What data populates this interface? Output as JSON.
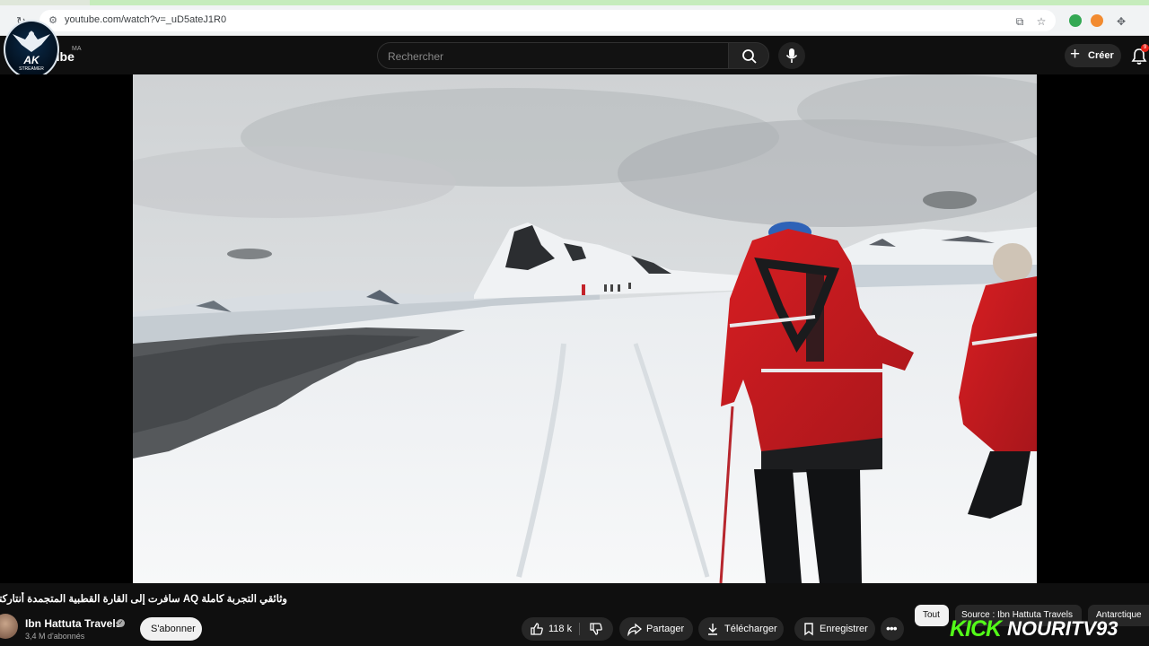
{
  "browser": {
    "url": "youtube.com/watch?v=_uD5ateJ1R0"
  },
  "header": {
    "logo_text": "ube",
    "country_code": "MA",
    "search_placeholder": "Rechercher",
    "create_label": "Créer",
    "notification_count": "9"
  },
  "overlay_badge": {
    "title": "AK",
    "subtitle": "STREAMER"
  },
  "video": {
    "title": "وثائقي التجربة كاملة AQ سافرت إلى القارة القطبية المتجمدة أنتاركتيكا",
    "channel_name": "Ibn Hattuta Travels",
    "subscribers": "3,4 M d'abonnés",
    "subscribe_label": "S'abonner"
  },
  "actions": {
    "likes": "118 k",
    "share_label": "Partager",
    "download_label": "Télécharger",
    "save_label": "Enregistrer"
  },
  "chips": [
    {
      "label": "Tout",
      "active": true
    },
    {
      "label": "Source : Ibn Hattuta Travels",
      "active": false
    },
    {
      "label": "Antarctique",
      "active": false
    }
  ],
  "stream_overlay": {
    "kick_label": "KICK",
    "streamer": "NOURITV93"
  }
}
